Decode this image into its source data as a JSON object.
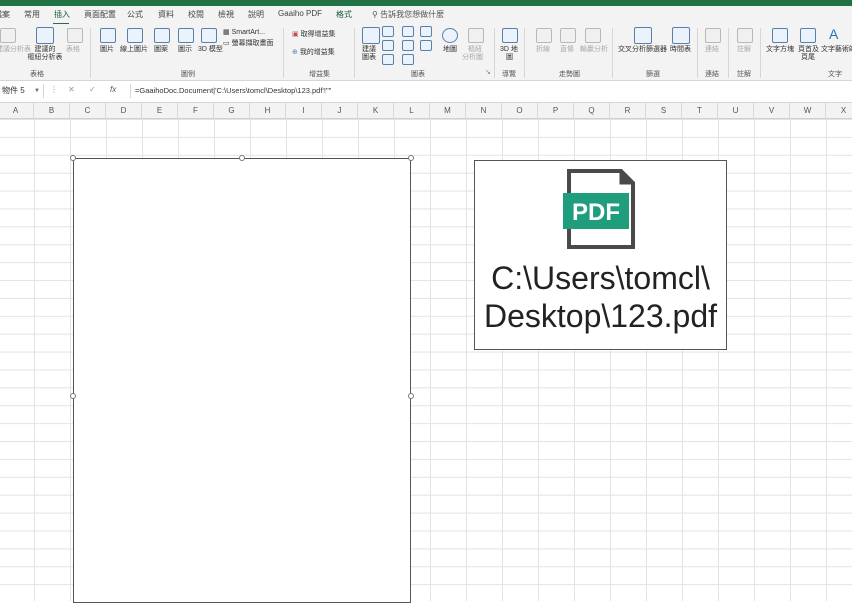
{
  "ribbon_tabs": [
    {
      "label": "檔案",
      "active": false
    },
    {
      "label": "常用",
      "active": false
    },
    {
      "label": "插入",
      "active": true
    },
    {
      "label": "頁面配置",
      "active": false
    },
    {
      "label": "公式",
      "active": false
    },
    {
      "label": "資料",
      "active": false
    },
    {
      "label": "校閱",
      "active": false
    },
    {
      "label": "檢視",
      "active": false
    },
    {
      "label": "說明",
      "active": false
    },
    {
      "label": "Gaaiho PDF",
      "active": false
    },
    {
      "label": "格式",
      "active": false
    }
  ],
  "tell_me": "告訴我您想做什麼",
  "ribbon": {
    "table_group": {
      "label": "表格",
      "pivot": "建議分析表",
      "rec_pivot_line1": "建議的",
      "rec_pivot_line2": "樞紐分析表",
      "table": "表格"
    },
    "illustrations_group": {
      "label": "圖例",
      "pictures": "圖片",
      "online_pictures": "線上圖片",
      "shapes": "圖案",
      "icons": "圖示",
      "model3d": "3D 模型",
      "smartart": "SmartArt...",
      "screenshot": "螢幕擷取畫面"
    },
    "addins_group": {
      "label": "增益集",
      "get_addins": "取得增益集",
      "my_addins": "我的增益集"
    },
    "charts_group": {
      "label": "圖表",
      "recommended_line1": "建議",
      "recommended_line2": "圖表",
      "maps": "地圖",
      "pivotchart_line1": "樞紐",
      "pivotchart_line2": "分析圖"
    },
    "tours_group": {
      "label": "導覽",
      "map3d_line1": "3D 地",
      "map3d_line2": "圖"
    },
    "sparklines_group": {
      "label": "走勢圖",
      "line": "折線",
      "column": "直條",
      "winloss": "輸贏分析"
    },
    "filters_group": {
      "label": "篩選",
      "slicer": "交叉分析篩選器",
      "timeline": "時間表"
    },
    "links_group": {
      "label": "連結",
      "link": "連結"
    },
    "comments_group": {
      "label": "註解",
      "comment": "註解"
    },
    "text_group": {
      "label": "文字",
      "textbox": "文字方塊",
      "header_line1": "頁首及",
      "header_line2": "頁尾",
      "wordart": "文字藝術師"
    }
  },
  "formula_bar": {
    "name_box": "物件 5",
    "cancel": "✕",
    "enter": "✓",
    "fx": "fx",
    "formula": "=GaaihoDoc.Document|'C:\\Users\\tomcl\\Desktop\\123.pdf'!\"\""
  },
  "columns": [
    "A",
    "B",
    "C",
    "D",
    "E",
    "F",
    "G",
    "H",
    "I",
    "J",
    "K",
    "L",
    "M",
    "N",
    "O",
    "P",
    "Q",
    "R",
    "S",
    "T",
    "U",
    "V",
    "W",
    "X"
  ],
  "pdf_object": {
    "icon_text": "PDF",
    "path_line1": "C:\\Users\\tomcl\\",
    "path_line2": "Desktop\\123.pdf",
    "accent": "#1f9e7e"
  },
  "colors": {
    "excel_green": "#217346",
    "grid": "#e3e3e3"
  }
}
